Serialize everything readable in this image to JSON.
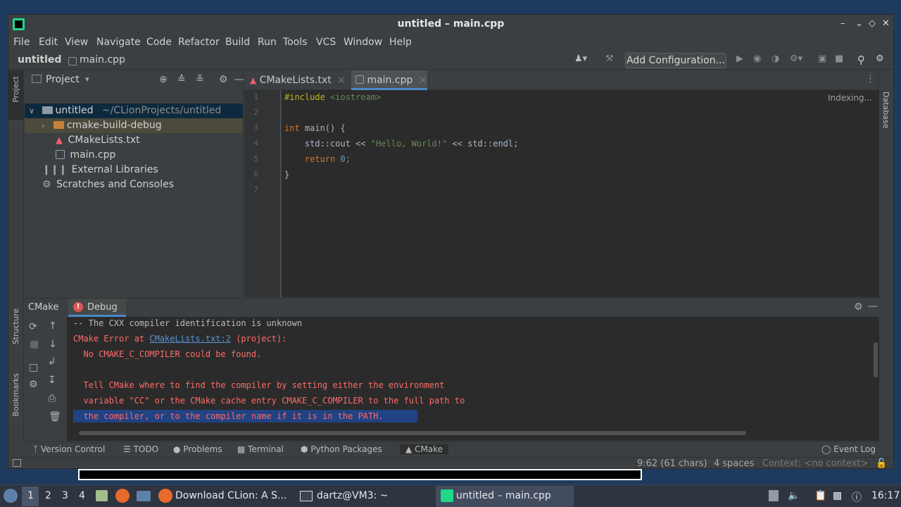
{
  "window": {
    "title": "untitled – main.cpp",
    "minimize": "–",
    "restore": "⌄",
    "maximize": "◇",
    "close": "✕"
  },
  "menu": [
    "File",
    "Edit",
    "View",
    "Navigate",
    "Code",
    "Refactor",
    "Build",
    "Run",
    "Tools",
    "VCS",
    "Window",
    "Help"
  ],
  "breadcrumb": {
    "project": "untitled",
    "file": "main.cpp"
  },
  "toolbar": {
    "add_configuration": "Add Configuration..."
  },
  "left_stripe": {
    "project": "Project",
    "structure": "Structure",
    "bookmarks": "Bookmarks"
  },
  "right_stripe": {
    "database": "Database"
  },
  "project_panel": {
    "title": "Project",
    "root": {
      "name": "untitled",
      "path": "~/CLionProjects/untitled"
    },
    "items": [
      "cmake-build-debug",
      "CMakeLists.txt",
      "main.cpp",
      "External Libraries",
      "Scratches and Consoles"
    ]
  },
  "tabs": [
    {
      "label": "CMakeLists.txt",
      "close": "×"
    },
    {
      "label": "main.cpp",
      "close": "×"
    }
  ],
  "editor": {
    "indexing": "Indexing...",
    "line_numbers": [
      "1",
      "2",
      "3",
      "4",
      "5",
      "6",
      "7"
    ],
    "line1_directive": "#include",
    "line1_header": "<iostream>",
    "line3_int": "int",
    "line3_rest": " main() {",
    "line4_a": "    std::cout << ",
    "line4_str": "\"Hello, World!\"",
    "line4_b": " << std::endl;",
    "line5_ret": "    return",
    "line5_sp": " ",
    "line5_num": "0",
    "line5_end": ";",
    "line6": "}"
  },
  "bottom_panel": {
    "tab_cmake": "CMake",
    "tab_debug": "Debug",
    "output": {
      "l1": "-- The CXX compiler identification is unknown",
      "l2_a": "CMake Error at ",
      "l2_link": "CMakeLists.txt:2",
      "l2_b": " (project):",
      "l3": "  No CMAKE_C_COMPILER could be found.",
      "l5": "  Tell CMake where to find the compiler by setting either the environment",
      "l6": "  variable \"CC\" or the CMake cache entry CMAKE_C_COMPILER to the full path to",
      "l7": "  the compiler, or to the compiler name if it is in the PATH."
    }
  },
  "tool_tabs": [
    "Version Control",
    "TODO",
    "Problems",
    "Terminal",
    "Python Packages",
    "CMake"
  ],
  "event_log": "Event Log",
  "status": {
    "position": "9:62 (61 chars)",
    "indent": "4 spaces",
    "context": "Context: <no context>"
  },
  "taskbar": {
    "workspaces": [
      "1",
      "2",
      "3",
      "4"
    ],
    "apps": [
      "Download CLion: A S...",
      "dartz@VM3: ~",
      "untitled – main.cpp"
    ],
    "clock": "16:17"
  }
}
